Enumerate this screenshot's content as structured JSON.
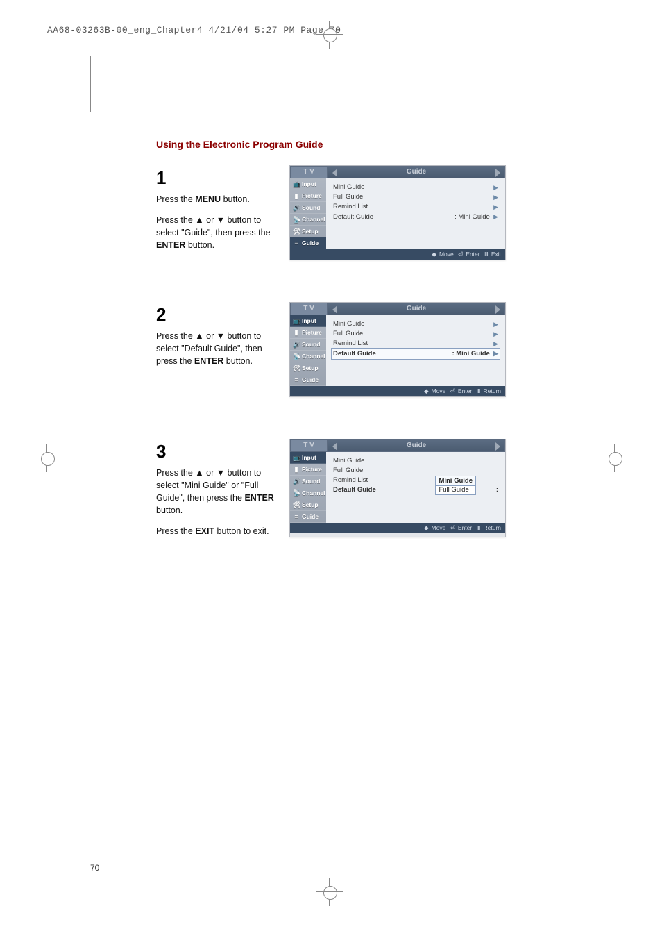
{
  "header_line": "AA68-03263B-00_eng_Chapter4  4/21/04  5:27 PM  Page 70",
  "page_number": "70",
  "section_title": "Using the Electronic Program Guide",
  "steps": [
    {
      "num": "1",
      "lines": [
        "Press the <b>MENU</b> button.",
        "",
        "Press the ▲ or ▼ button to select \"Guide\", then press the <b>ENTER</b> button."
      ]
    },
    {
      "num": "2",
      "lines": [
        "Press the ▲ or ▼ button to select \"Default Guide\", then press the <b>ENTER</b> button."
      ]
    },
    {
      "num": "3",
      "lines": [
        "Press the ▲ or ▼ button to select \"Mini Guide\" or \"Full Guide\", then press the <b>ENTER</b> button.",
        "",
        "Press the <b>EXIT</b> button to exit."
      ]
    }
  ],
  "tv": {
    "tv_label": "T V",
    "title": "Guide",
    "side_tabs": [
      "Input",
      "Picture",
      "Sound",
      "Channel",
      "Setup",
      "Guide"
    ],
    "rows": [
      "Mini Guide",
      "Full Guide",
      "Remind List",
      "Default Guide"
    ],
    "default_value": ":   Mini Guide",
    "footer_move": "Move",
    "footer_enter": "Enter",
    "footer_exit": "Exit",
    "footer_return": "Return"
  },
  "dropdown": {
    "options": [
      "Mini Guide",
      "Full Guide"
    ]
  }
}
